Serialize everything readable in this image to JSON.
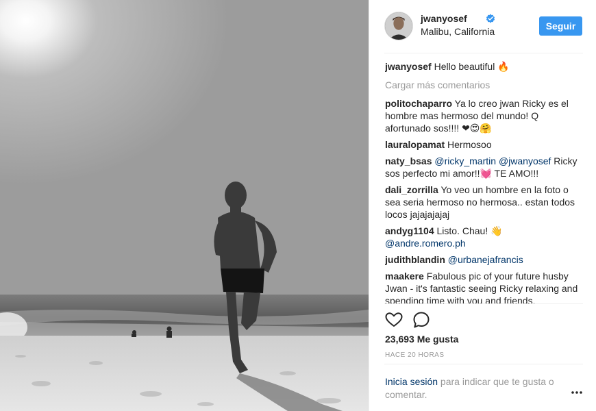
{
  "post": {
    "username": "jwanyosef",
    "location": "Malibu, California",
    "follow_label": "Seguir",
    "caption": {
      "user": "jwanyosef",
      "text": "Hello beautiful 🔥"
    },
    "load_more": "Cargar más comentarios",
    "comments": [
      {
        "user": "politochaparro",
        "text": "Ya lo creo jwan Ricky es el hombre mas hermoso del mundo! Q afortunado sos!!!! ❤😍🤗"
      },
      {
        "user": "lauralopamat",
        "text": "Hermosoo"
      },
      {
        "user": "naty_bsas",
        "mention1": "@ricky_martin",
        "mention2": "@jwanyosef",
        "text": "Ricky sos perfecto mi amor!!💓 TE AMO!!!"
      },
      {
        "user": "dali_zorrilla",
        "text": "Yo veo un hombre en la foto o sea seria hermoso no hermosa.. estan todos locos jajajajajaj"
      },
      {
        "user": "andyg1104",
        "text": "Listo. Chau! 👋",
        "mention": "@andre.romero.ph"
      },
      {
        "user": "judithblandin",
        "mention": "@urbanejafrancis"
      },
      {
        "user": "maakere",
        "text": "Fabulous pic of your future husby Jwan - it's fantastic seeing Ricky relaxing and spending time with you and friends."
      }
    ],
    "likes": "23,693 Me gusta",
    "time": "HACE 20 HORAS",
    "login_link": "Inicia sesión",
    "login_text": " para indicar que te gusta o comentar."
  },
  "icons": {
    "verified": "verified-badge-icon",
    "like": "heart-icon",
    "comment": "comment-icon",
    "more": "more-options-icon"
  },
  "colors": {
    "follow_button": "#3897f0",
    "verified": "#3897f0",
    "mention": "#003569",
    "muted": "#999999"
  }
}
